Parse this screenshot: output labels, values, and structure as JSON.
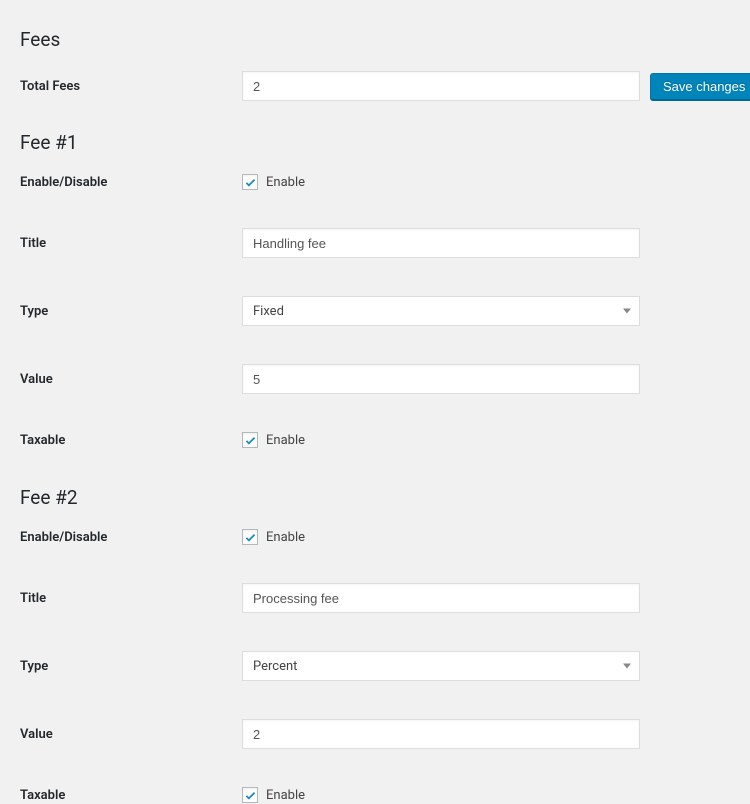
{
  "sections": {
    "fees_heading": "Fees",
    "fee1_heading": "Fee #1",
    "fee2_heading": "Fee #2"
  },
  "labels": {
    "total_fees": "Total Fees",
    "enable_disable": "Enable/Disable",
    "title": "Title",
    "type": "Type",
    "value": "Value",
    "taxable": "Taxable",
    "enable_cb": "Enable",
    "save": "Save changes"
  },
  "values": {
    "total_fees": "2",
    "fee1": {
      "enabled": true,
      "title": "Handling fee",
      "type": "Fixed",
      "value": "5",
      "taxable": true
    },
    "fee2": {
      "enabled": true,
      "title": "Processing fee",
      "type": "Percent",
      "value": "2",
      "taxable": true
    }
  }
}
